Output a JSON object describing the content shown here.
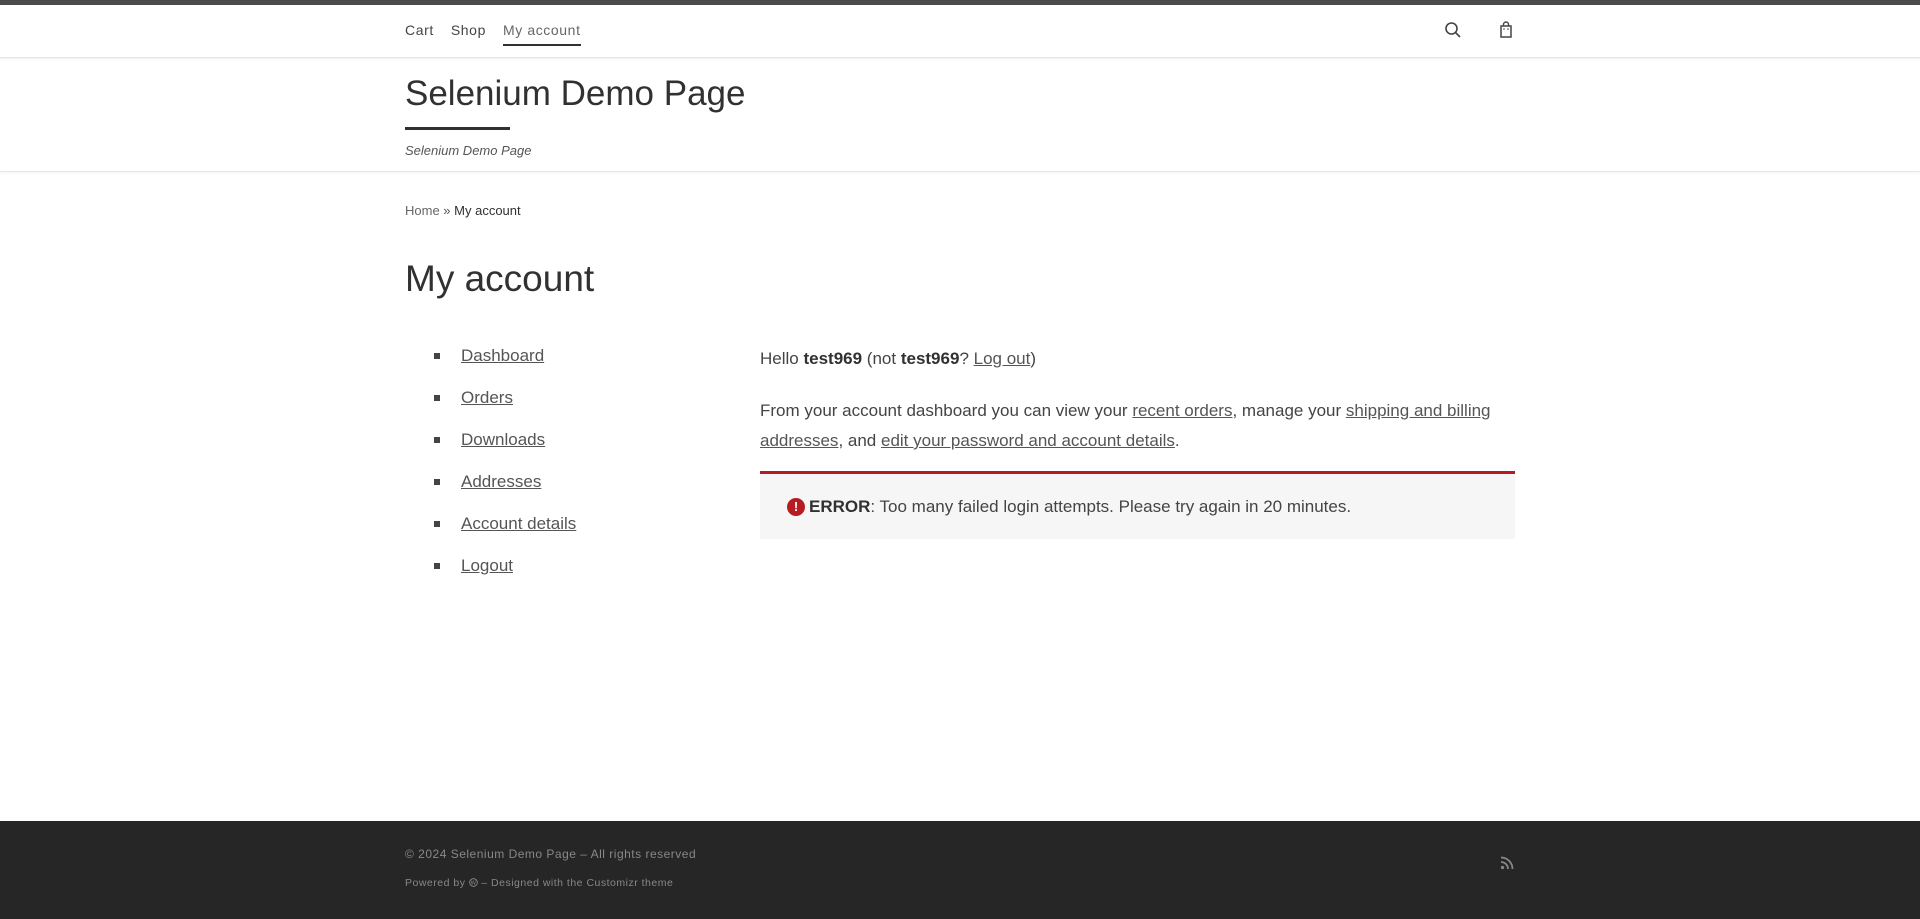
{
  "nav": {
    "items": [
      {
        "label": "Cart"
      },
      {
        "label": "Shop"
      },
      {
        "label": "My account"
      }
    ],
    "icons": [
      "search-icon",
      "cart-icon"
    ]
  },
  "header": {
    "site_title": "Selenium Demo Page",
    "tagline": "Selenium Demo Page"
  },
  "breadcrumb": {
    "home": "Home",
    "separator": " » ",
    "current": "My account"
  },
  "page_title": "My account",
  "account_nav": [
    {
      "label": "Dashboard"
    },
    {
      "label": "Orders"
    },
    {
      "label": "Downloads"
    },
    {
      "label": "Addresses"
    },
    {
      "label": "Account details"
    },
    {
      "label": "Logout"
    }
  ],
  "dashboard": {
    "hello_prefix": "Hello ",
    "username": "test969",
    "not_prefix": " (not ",
    "username2": "test969",
    "question": "? ",
    "logout_link": "Log out",
    "close_paren": ")",
    "p2_part1": "From your account dashboard you can view your ",
    "recent_orders_link": "recent orders",
    "p2_part2": ", manage your ",
    "addresses_link": "shipping and billing addresses",
    "p2_part3": ", and ",
    "account_details_link": "edit your password and account details",
    "p2_part4": "."
  },
  "error": {
    "icon": "!",
    "label": "ERROR",
    "message": ": Too many failed login attempts. Please try again in 20 minutes."
  },
  "footer": {
    "copyright": "© 2024 Selenium Demo Page – All rights reserved",
    "powered_prefix": "Powered by",
    "powered_suffix": "– Designed with the Customizr theme"
  },
  "colors": {
    "error_accent": "#b81c23",
    "footer_bg": "#262626"
  }
}
